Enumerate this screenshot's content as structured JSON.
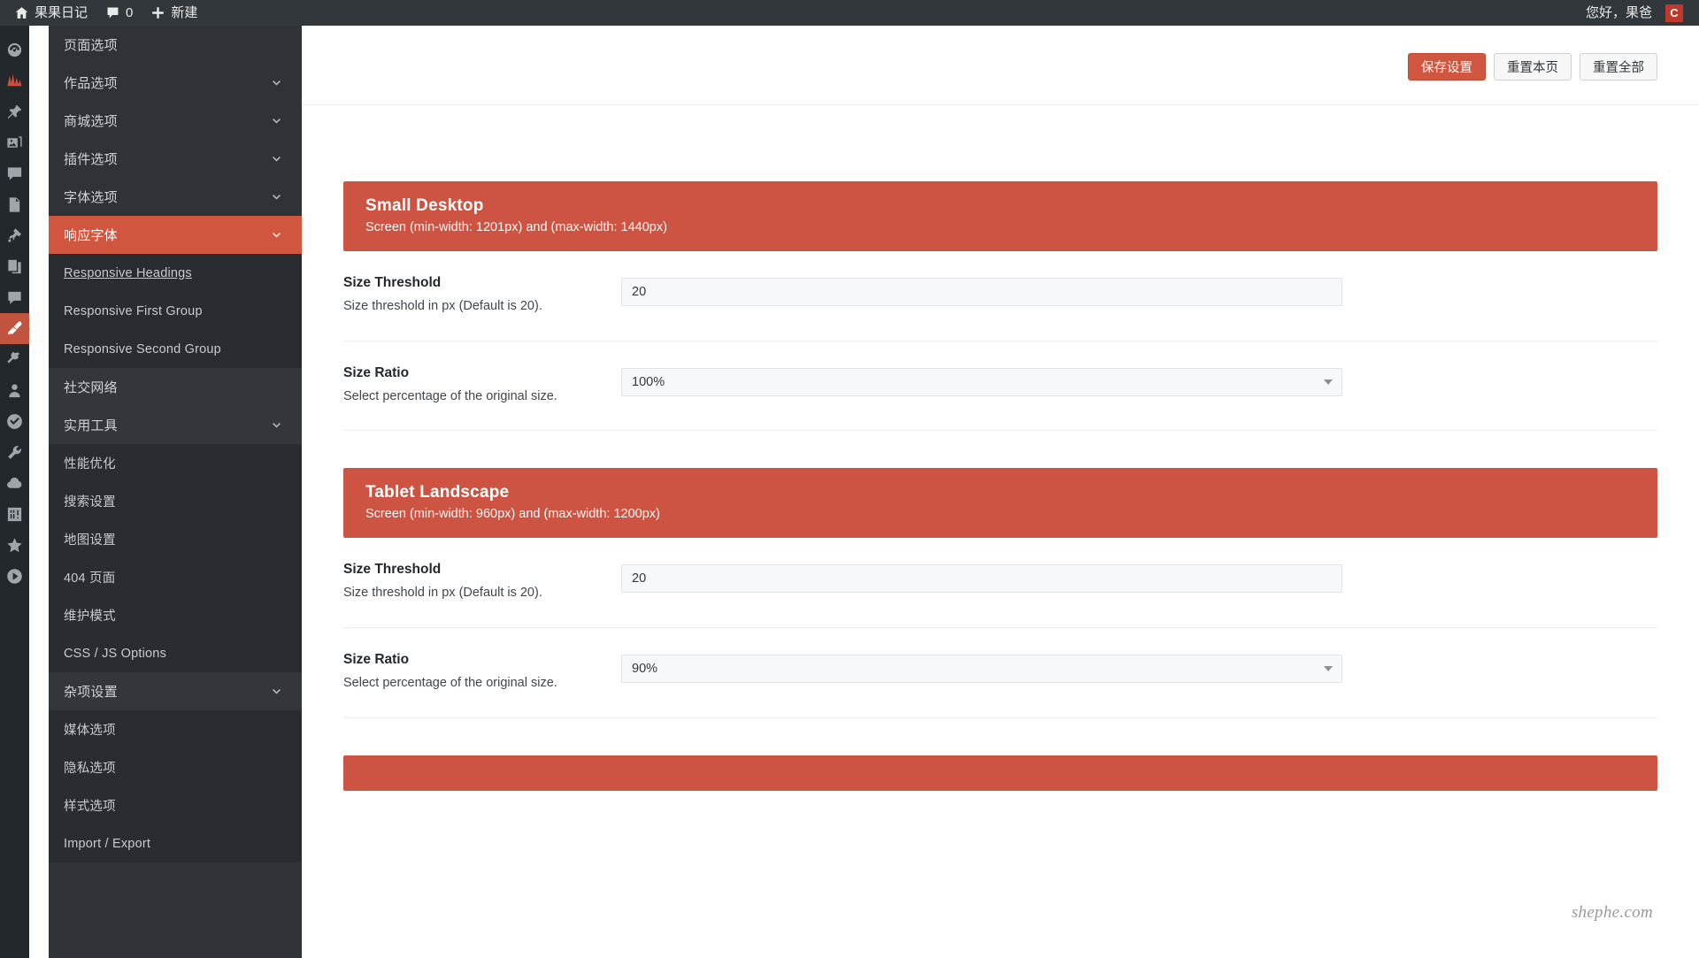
{
  "adminbar": {
    "site_name": "果果日记",
    "comments_count": "0",
    "new_label": "新建",
    "greeting": "您好，果爸",
    "avatar_letter": "C",
    "icons": {
      "home": "home-icon",
      "comment": "comment-icon",
      "plus": "plus-icon"
    }
  },
  "iconrail": {
    "items": [
      {
        "name": "dashboard-icon",
        "state": "normal"
      },
      {
        "name": "analytics-icon",
        "state": "red"
      },
      {
        "name": "pin-icon",
        "state": "normal"
      },
      {
        "name": "media-icon",
        "state": "normal"
      },
      {
        "name": "comments-icon",
        "state": "normal"
      },
      {
        "name": "pages-icon",
        "state": "normal"
      },
      {
        "name": "plugins-puzzle-icon",
        "state": "normal"
      },
      {
        "name": "duplicate-pages-icon",
        "state": "normal"
      },
      {
        "name": "speech-bubble-icon",
        "state": "normal"
      },
      {
        "name": "appearance-brush-icon",
        "state": "active"
      },
      {
        "name": "plugin-plug-icon",
        "state": "normal"
      },
      {
        "name": "users-icon",
        "state": "normal"
      },
      {
        "name": "check-badge-icon",
        "state": "normal"
      },
      {
        "name": "tools-wrench-icon",
        "state": "normal"
      },
      {
        "name": "cloud-icon",
        "state": "normal"
      },
      {
        "name": "settings-sliders-icon",
        "state": "normal"
      },
      {
        "name": "star-icon",
        "state": "normal"
      },
      {
        "name": "play-circle-icon",
        "state": "normal"
      }
    ]
  },
  "sidebar": {
    "items": [
      {
        "label": "页面选项",
        "type": "top",
        "chevron": false,
        "state": "normal"
      },
      {
        "label": "作品选项",
        "type": "top",
        "chevron": true,
        "state": "normal"
      },
      {
        "label": "商城选项",
        "type": "top",
        "chevron": true,
        "state": "normal"
      },
      {
        "label": "插件选项",
        "type": "top",
        "chevron": true,
        "state": "normal"
      },
      {
        "label": "字体选项",
        "type": "top",
        "chevron": true,
        "state": "normal"
      },
      {
        "label": "响应字体",
        "type": "top",
        "chevron": true,
        "state": "active"
      },
      {
        "label": "Responsive Headings",
        "type": "sub",
        "chevron": false,
        "state": "current"
      },
      {
        "label": "Responsive First Group",
        "type": "sub",
        "chevron": false,
        "state": "normal"
      },
      {
        "label": "Responsive Second Group",
        "type": "sub",
        "chevron": false,
        "state": "normal"
      },
      {
        "label": "社交网络",
        "type": "top",
        "chevron": false,
        "state": "shade"
      },
      {
        "label": "实用工具",
        "type": "top",
        "chevron": true,
        "state": "shade"
      },
      {
        "label": "性能优化",
        "type": "sub",
        "chevron": false,
        "state": "normal"
      },
      {
        "label": "搜索设置",
        "type": "sub",
        "chevron": false,
        "state": "normal"
      },
      {
        "label": "地图设置",
        "type": "sub",
        "chevron": false,
        "state": "normal"
      },
      {
        "label": "404 页面",
        "type": "sub",
        "chevron": false,
        "state": "normal"
      },
      {
        "label": "维护模式",
        "type": "sub",
        "chevron": false,
        "state": "normal"
      },
      {
        "label": "CSS / JS Options",
        "type": "sub",
        "chevron": false,
        "state": "normal"
      },
      {
        "label": "杂项设置",
        "type": "top",
        "chevron": true,
        "state": "shade"
      },
      {
        "label": "媒体选项",
        "type": "sub",
        "chevron": false,
        "state": "normal"
      },
      {
        "label": "隐私选项",
        "type": "sub",
        "chevron": false,
        "state": "normal"
      },
      {
        "label": "样式选项",
        "type": "sub",
        "chevron": false,
        "state": "normal"
      },
      {
        "label": "Import / Export",
        "type": "sub",
        "chevron": false,
        "state": "normal"
      }
    ]
  },
  "toolbar": {
    "save_label": "保存设置",
    "reset_page_label": "重置本页",
    "reset_all_label": "重置全部"
  },
  "sections": [
    {
      "title": "Small Desktop",
      "subtitle": "Screen (min-width: 1201px) and (max-width: 1440px)",
      "fields": [
        {
          "title": "Size Threshold",
          "desc": "Size threshold in px (Default is 20).",
          "control": "text",
          "value": "20"
        },
        {
          "title": "Size Ratio",
          "desc": "Select percentage of the original size.",
          "control": "select",
          "value": "100%"
        }
      ]
    },
    {
      "title": "Tablet Landscape",
      "subtitle": "Screen (min-width: 960px) and (max-width: 1200px)",
      "fields": [
        {
          "title": "Size Threshold",
          "desc": "Size threshold in px (Default is 20).",
          "control": "text",
          "value": "20"
        },
        {
          "title": "Size Ratio",
          "desc": "Select percentage of the original size.",
          "control": "select",
          "value": "90%"
        }
      ]
    },
    {
      "title": "",
      "subtitle": "",
      "fields": []
    }
  ],
  "watermark": "shephe.com",
  "colors": {
    "accent": "#d0563f",
    "banner": "#cd5442",
    "adminbar": "#32373c",
    "rail": "#23282d",
    "sidebar": "#2f3337",
    "sidebar_sub": "#292d31"
  }
}
